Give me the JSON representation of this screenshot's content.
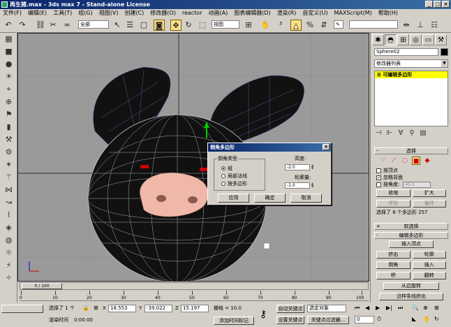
{
  "window": {
    "title": "再生猪.max - 3ds max 7 - Stand-alone License"
  },
  "menu": [
    "文件(F)",
    "编辑(E)",
    "工具(T)",
    "组(G)",
    "视图(V)",
    "创建(C)",
    "修改器(O)",
    "reactor",
    "动画(A)",
    "图表编辑器(D)",
    "渲染(R)",
    "自定义(U)",
    "MAXScript(M)",
    "帮助(H)"
  ],
  "toolbar": {
    "selection_filter": "全部",
    "ref_coord": "视图"
  },
  "command_panel": {
    "object_name": "Sphere02",
    "modifier_list": "修改器列表",
    "stack_item": "可编辑多边形",
    "selection": {
      "header": "选择",
      "by_vertex": "按顶点",
      "ignore_backfacing": "忽略背面",
      "by_angle": "按角度:",
      "by_angle_value": "45.0",
      "shrink": "收缩",
      "grow": "扩大",
      "ring": "环形",
      "loop": "循环",
      "selected_info": "选择了 8 个多边形 257"
    },
    "soft_selection": "软选择",
    "edit_polygons": {
      "header": "编辑多边形",
      "insert_vertex": "插入顶点",
      "extrude": "挤出",
      "outline": "轮廓",
      "bevel": "倒角",
      "inset": "插入",
      "bridge": "桥",
      "flip": "翻转",
      "hinge_from_edge": "从边旋转",
      "extrude_along_spline": "沿样条线挤出"
    }
  },
  "dialog": {
    "title": "倒角多边形",
    "group_label": "倒角类型",
    "options": [
      "组",
      "局部法线",
      "按多边形"
    ],
    "selected_option": 0,
    "height_label": "高度:",
    "height_value": "-2.0",
    "outline_label": "轮廓量:",
    "outline_value": "-1.0",
    "apply": "应用",
    "ok": "确定",
    "cancel": "取消"
  },
  "timeline": {
    "frame": "0 / 100",
    "ticks": [
      "0",
      "10",
      "20",
      "30",
      "40",
      "50",
      "60",
      "70",
      "80",
      "90",
      "100"
    ]
  },
  "status": {
    "selected": "选择了 1 个",
    "x_label": "X",
    "x": "18.553",
    "y_label": "Y",
    "y": "-39.022",
    "z_label": "Z",
    "z": "15.197",
    "grid": "栅格 = 10.0",
    "render_time_label": "渲染时间",
    "render_time": "0:00:00",
    "add_time_tag": "添加时间标记",
    "auto_key": "自动关键点",
    "set_key": "设置关键点",
    "selected_object": "选定对象",
    "key_filters": "关键点过滤器...",
    "frame_field": "0"
  },
  "colors": {
    "accent": "#f7e08a",
    "title": "#0a246a",
    "stack_highlight": "#ffff00"
  }
}
